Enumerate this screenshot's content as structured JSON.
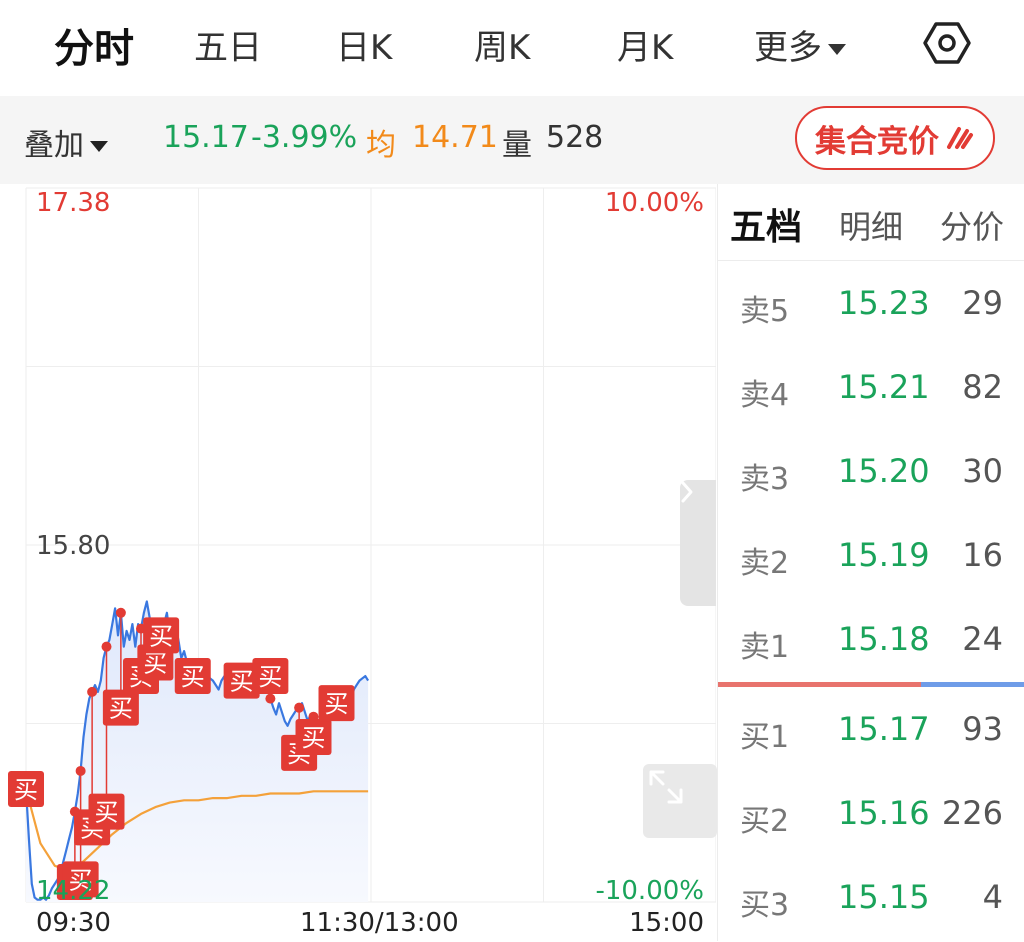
{
  "tabs": [
    {
      "label": "分时",
      "active": true
    },
    {
      "label": "五日"
    },
    {
      "label": "日K"
    },
    {
      "label": "周K"
    },
    {
      "label": "月K"
    },
    {
      "label": "更多"
    }
  ],
  "icons": {
    "settings": "hexagon-settings-icon",
    "more": "chevron-down-icon",
    "auction": "lightning-icon"
  },
  "infobar": {
    "overlay_label": "叠加",
    "price": "15.17",
    "change_pct": "-3.99%",
    "avg_label": "均",
    "avg_value": "14.71",
    "volume_label": "量",
    "volume_value": "528",
    "auction_label": "集合竞价"
  },
  "chart_labels": {
    "top_price": "17.38",
    "mid_price": "15.80",
    "bottom_price": "14.22",
    "top_pct": "10.00%",
    "bottom_pct": "-10.00%",
    "time_start": "09:30",
    "time_mid": "11:30/13:00",
    "time_end": "15:00"
  },
  "chart_data": {
    "type": "line",
    "ylim": [
      14.22,
      17.38
    ],
    "series": [
      {
        "key": "price",
        "color": "#3a78e0",
        "x": [
          0,
          1,
          2,
          3,
          4,
          5,
          6,
          7,
          8,
          9,
          10,
          11,
          12,
          13,
          14,
          15,
          16,
          17,
          18,
          19,
          20,
          21,
          22,
          23,
          24,
          25,
          26,
          27,
          28,
          29,
          30,
          31,
          32,
          33,
          34,
          35,
          36,
          37,
          38,
          39,
          40,
          41,
          42,
          43,
          44,
          45,
          46,
          47,
          48,
          49,
          50,
          51,
          52,
          53,
          54,
          55,
          56,
          57,
          58,
          59,
          60,
          61,
          62,
          63,
          64,
          65,
          66,
          67,
          68,
          69,
          70,
          71,
          72,
          73,
          74,
          75,
          76,
          77,
          78,
          79,
          80,
          81,
          82,
          83,
          84,
          85,
          86,
          87,
          88,
          89,
          90,
          91,
          92,
          93,
          94,
          95,
          96,
          97,
          98,
          99,
          100,
          101,
          102,
          103,
          104,
          105,
          106,
          107,
          108,
          109,
          110,
          111,
          112,
          113,
          114,
          115,
          116,
          117,
          118,
          119
        ],
        "y": [
          14.72,
          14.5,
          14.3,
          14.24,
          14.23,
          14.23,
          14.24,
          14.23,
          14.25,
          14.28,
          14.3,
          14.32,
          14.35,
          14.4,
          14.45,
          14.5,
          14.55,
          14.62,
          14.7,
          14.8,
          14.95,
          15.05,
          15.12,
          15.15,
          15.18,
          15.15,
          15.2,
          15.3,
          15.35,
          15.38,
          15.45,
          15.52,
          15.4,
          15.5,
          15.35,
          15.42,
          15.38,
          15.45,
          15.35,
          15.45,
          15.43,
          15.5,
          15.55,
          15.48,
          15.4,
          15.36,
          15.42,
          15.38,
          15.45,
          15.5,
          15.4,
          15.46,
          15.44,
          15.38,
          15.3,
          15.33,
          15.28,
          15.25,
          15.22,
          15.2,
          15.18,
          15.22,
          15.19,
          15.17,
          15.21,
          15.2,
          15.18,
          15.16,
          15.2,
          15.22,
          15.19,
          15.21,
          15.18,
          15.17,
          15.22,
          15.2,
          15.21,
          15.24,
          15.18,
          15.21,
          15.23,
          15.2,
          15.24,
          15.22,
          15.18,
          15.12,
          15.08,
          15.05,
          15.1,
          15.06,
          15.02,
          15.0,
          15.03,
          15.05,
          15.07,
          15.08,
          15.1,
          15.06,
          15.02,
          15.05,
          15.04,
          15.0,
          14.98,
          15.02,
          15.05,
          15.03,
          15.08,
          15.1,
          15.11,
          15.08,
          15.13,
          15.15,
          15.12,
          15.1,
          15.16,
          15.18,
          15.2,
          15.21,
          15.22,
          15.2
        ]
      },
      {
        "key": "average",
        "color": "#f4a13a",
        "x": [
          0,
          5,
          10,
          15,
          20,
          25,
          30,
          35,
          40,
          45,
          50,
          55,
          60,
          65,
          70,
          75,
          80,
          85,
          90,
          95,
          100,
          105,
          110,
          115,
          119
        ],
        "y": [
          14.72,
          14.48,
          14.38,
          14.36,
          14.4,
          14.46,
          14.52,
          14.57,
          14.61,
          14.64,
          14.66,
          14.67,
          14.67,
          14.68,
          14.68,
          14.69,
          14.69,
          14.7,
          14.7,
          14.7,
          14.71,
          14.71,
          14.71,
          14.71,
          14.71
        ]
      }
    ],
    "trade_markers": [
      {
        "label": "买",
        "x": 0,
        "y": 14.72
      },
      {
        "label": "买",
        "x": 17,
        "y": 14.22
      },
      {
        "label": "买",
        "x": 19,
        "y": 14.32
      },
      {
        "label": "买",
        "x": 23,
        "y": 14.55
      },
      {
        "label": "买",
        "x": 28,
        "y": 14.62
      },
      {
        "label": "买",
        "x": 33,
        "y": 15.08
      },
      {
        "label": "买",
        "x": 40,
        "y": 15.22
      },
      {
        "label": "买",
        "x": 45,
        "y": 15.28
      },
      {
        "label": "买",
        "x": 47,
        "y": 15.4
      },
      {
        "label": "买",
        "x": 58,
        "y": 15.22
      },
      {
        "label": "买",
        "x": 75,
        "y": 15.2
      },
      {
        "label": "买",
        "x": 85,
        "y": 15.22
      },
      {
        "label": "买",
        "x": 95,
        "y": 14.88
      },
      {
        "label": "买",
        "x": 100,
        "y": 14.95
      },
      {
        "label": "买",
        "x": 108,
        "y": 15.1
      }
    ]
  },
  "book_tabs": [
    "五档",
    "明细",
    "分价"
  ],
  "order_book": {
    "asks": [
      {
        "label": "卖5",
        "price": "15.23",
        "volume": "29"
      },
      {
        "label": "卖4",
        "price": "15.21",
        "volume": "82"
      },
      {
        "label": "卖3",
        "price": "15.20",
        "volume": "30"
      },
      {
        "label": "卖2",
        "price": "15.19",
        "volume": "16"
      },
      {
        "label": "卖1",
        "price": "15.18",
        "volume": "24"
      }
    ],
    "bids": [
      {
        "label": "买1",
        "price": "15.17",
        "volume": "93"
      },
      {
        "label": "买2",
        "price": "15.16",
        "volume": "226"
      },
      {
        "label": "买3",
        "price": "15.15",
        "volume": "4"
      }
    ]
  },
  "colors": {
    "up": "#e23b34",
    "down": "#1aa35a",
    "avg": "#f28a1a",
    "line": "#3a78e0"
  }
}
